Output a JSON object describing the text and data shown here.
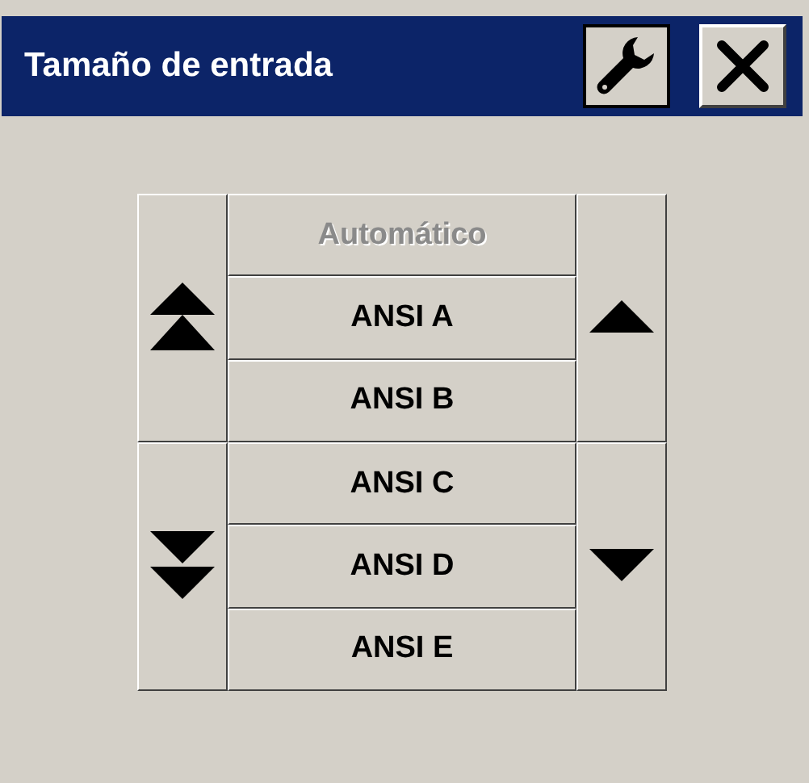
{
  "window": {
    "title": "Tamaño de entrada"
  },
  "items": [
    {
      "label": "Automático",
      "disabled": true
    },
    {
      "label": "ANSI A",
      "disabled": false
    },
    {
      "label": "ANSI B",
      "disabled": false
    },
    {
      "label": "ANSI C",
      "disabled": false
    },
    {
      "label": "ANSI D",
      "disabled": false
    },
    {
      "label": "ANSI E",
      "disabled": false
    }
  ]
}
